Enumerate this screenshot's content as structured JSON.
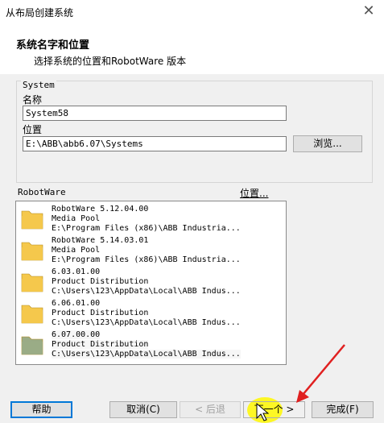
{
  "window": {
    "title": "从布局创建系统",
    "close_glyph": "✕"
  },
  "header": {
    "title": "系统名字和位置",
    "subtitle": "选择系统的位置和RobotWare 版本"
  },
  "system": {
    "legend": "System",
    "name_label": "名称",
    "name_value": "System58",
    "location_label": "位置",
    "location_value": "E:\\ABB\\abb6.07\\Systems",
    "browse_label": "浏览..."
  },
  "robotware": {
    "label": "RobotWare",
    "location_link": "位置...",
    "items": [
      {
        "lines": [
          "RobotWare 5.12.04.00",
          "Media Pool",
          "E:\\Program Files (x86)\\ABB Industria..."
        ],
        "icon": "folder-icon",
        "color": "#f5c84c"
      },
      {
        "lines": [
          "RobotWare 5.14.03.01",
          "Media Pool",
          "E:\\Program Files (x86)\\ABB Industria..."
        ],
        "icon": "folder-icon",
        "color": "#f5c84c"
      },
      {
        "lines": [
          "6.03.01.00",
          "Product Distribution",
          "C:\\Users\\123\\AppData\\Local\\ABB Indus..."
        ],
        "icon": "folder-icon",
        "color": "#f5c84c"
      },
      {
        "lines": [
          "6.06.01.00",
          "Product Distribution",
          "C:\\Users\\123\\AppData\\Local\\ABB Indus..."
        ],
        "icon": "folder-icon",
        "color": "#f5c84c"
      },
      {
        "lines": [
          "6.07.00.00",
          "Product Distribution",
          "C:\\Users\\123\\AppData\\Local\\ABB Indus..."
        ],
        "icon": "folder-icon",
        "color": "#9aab86"
      }
    ]
  },
  "footer": {
    "help": "帮助",
    "cancel": "取消(C)",
    "back": "< 后退",
    "next": "下一个 >",
    "finish": "完成(F)"
  },
  "colors": {
    "highlight": "#fff800",
    "arrow": "#e02020",
    "accent": "#0078d7"
  }
}
